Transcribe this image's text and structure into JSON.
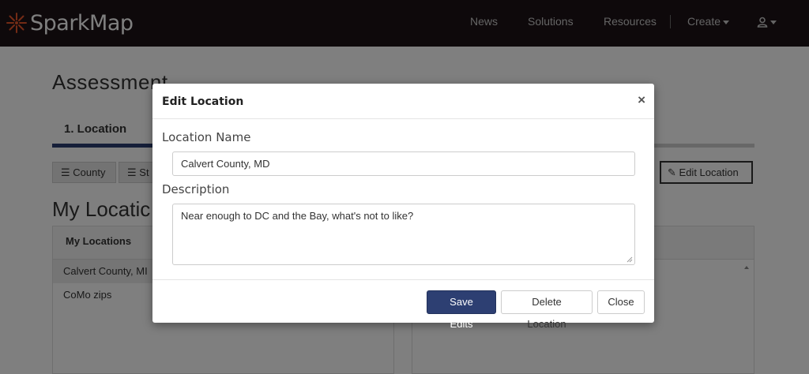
{
  "brand": {
    "name": "SparkMap",
    "accent": "#e8562a"
  },
  "nav": {
    "items": [
      "News",
      "Solutions",
      "Resources"
    ],
    "create_label": "Create",
    "user_icon": "user-icon"
  },
  "page": {
    "title": "Assessment",
    "step_tab": "1. Location",
    "buttons": [
      "County",
      "St"
    ],
    "edit_location_label": "Edit Location",
    "section_title": "My Locatic",
    "my_locations_header": "My Locations",
    "locations": [
      "Calvert County, MI",
      "CoMo zips"
    ]
  },
  "modal": {
    "title": "Edit Location",
    "close_glyph": "×",
    "name_label": "Location Name",
    "name_value": "Calvert County, MD",
    "description_label": "Description",
    "description_value": "Near enough to DC and the Bay, what's not to like?",
    "save_label": "Save Edits",
    "delete_label": "Delete Location",
    "close_label": "Close"
  },
  "colors": {
    "nav_bg": "#1c1317",
    "primary": "#2d3f72"
  }
}
